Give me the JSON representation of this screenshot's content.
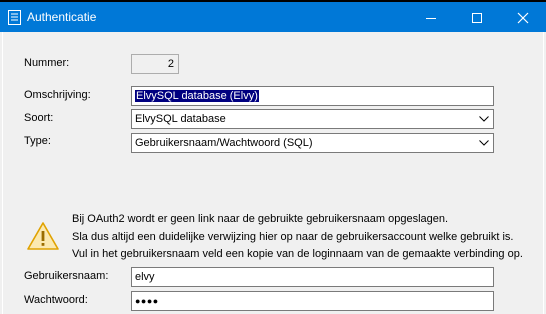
{
  "window": {
    "title": "Authenticatie",
    "icons": {
      "app": "document-icon",
      "minimize": "minimize-icon",
      "maximize": "maximize-icon",
      "close": "close-icon"
    }
  },
  "form": {
    "nummer": {
      "label": "Nummer:",
      "value": "2"
    },
    "omschrijving": {
      "label": "Omschrijving:",
      "value": "ElvySQL database (Elvy)"
    },
    "soort": {
      "label": "Soort:",
      "value": "ElvySQL database"
    },
    "type": {
      "label": "Type:",
      "value": "Gebruikersnaam/Wachtwoord (SQL)"
    }
  },
  "notice": {
    "icon": "warning-icon",
    "lines": [
      "Bij OAuth2 wordt er geen link naar de gebruikte gebruikersnaam opgeslagen.",
      "Sla dus altijd een duidelijke verwijzing hier op naar de gebruikersaccount welke gebruikt is.",
      "Vul in het gebruikersnaam veld een kopie van de loginnaam van de gemaakte verbinding op."
    ]
  },
  "credentials": {
    "username": {
      "label": "Gebruikersnaam:",
      "value": "elvy"
    },
    "password": {
      "label": "Wachtwoord:",
      "value": "●●●●"
    }
  },
  "colors": {
    "titlebar": "#0078d7",
    "selection": "#000080",
    "warning": "#f4b400"
  }
}
